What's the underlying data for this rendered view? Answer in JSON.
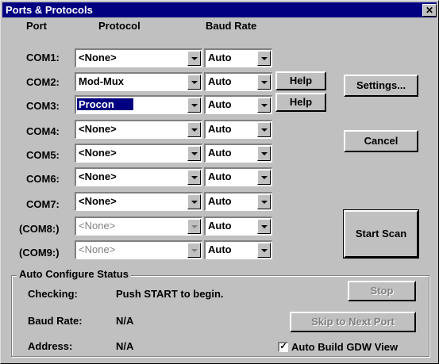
{
  "window": {
    "title": "Ports & Protocols",
    "close_glyph": "✕"
  },
  "headers": {
    "port": "Port",
    "protocol": "Protocol",
    "baud": "Baud Rate"
  },
  "ports": [
    {
      "label": "COM1:",
      "protocol": "<None>",
      "baud": "Auto",
      "enabled": true
    },
    {
      "label": "COM2:",
      "protocol": "Mod-Mux",
      "baud": "Auto",
      "enabled": true
    },
    {
      "label": "COM3:",
      "protocol": "Procon",
      "baud": "Auto",
      "enabled": true
    },
    {
      "label": "COM4:",
      "protocol": "<None>",
      "baud": "Auto",
      "enabled": true
    },
    {
      "label": "COM5:",
      "protocol": "<None>",
      "baud": "Auto",
      "enabled": true
    },
    {
      "label": "COM6:",
      "protocol": "<None>",
      "baud": "Auto",
      "enabled": true
    },
    {
      "label": "COM7:",
      "protocol": "<None>",
      "baud": "Auto",
      "enabled": true
    },
    {
      "label": "(COM8:)",
      "protocol": "<None>",
      "baud": "Auto",
      "enabled": false
    },
    {
      "label": "(COM9:)",
      "protocol": "<None>",
      "baud": "Auto",
      "enabled": false
    }
  ],
  "buttons": {
    "help": "Help",
    "settings": "Settings...",
    "cancel": "Cancel",
    "start_scan": "Start Scan",
    "stop": "Stop",
    "skip": "Skip to Next Port"
  },
  "status": {
    "group_title": "Auto Configure Status",
    "checking_label": "Checking:",
    "checking_value": "Push START to begin.",
    "baud_label": "Baud Rate:",
    "baud_value": "N/A",
    "address_label": "Address:",
    "address_value": "N/A"
  },
  "auto_build": {
    "label": "Auto Build GDW View",
    "checked": true,
    "check_glyph": "✓"
  }
}
